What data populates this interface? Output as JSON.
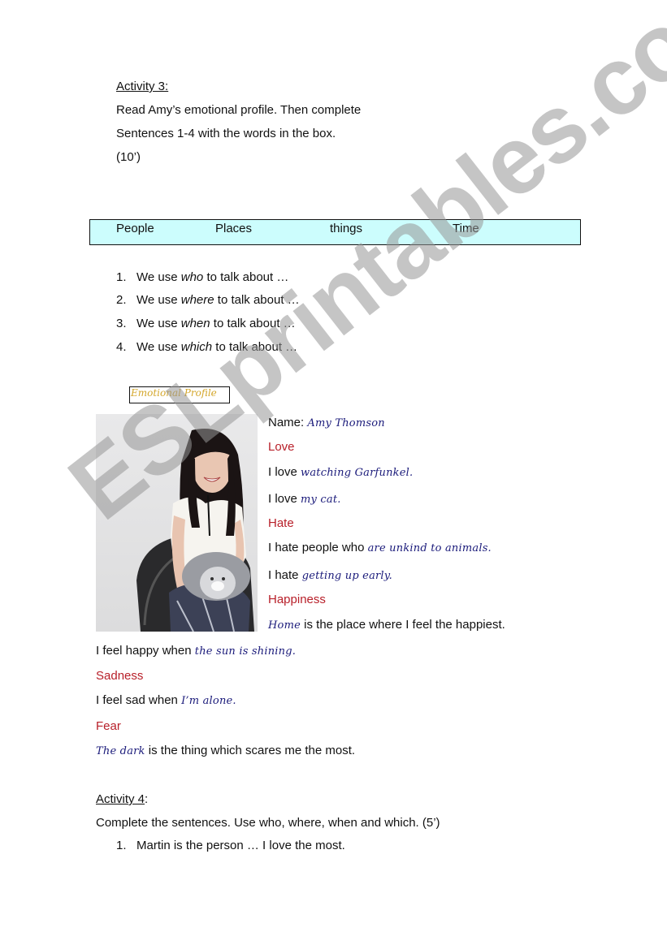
{
  "activity3": {
    "heading": "Activity 3:",
    "instruction_line1": "Read Amy’s emotional profile. Then complete",
    "instruction_line2": "Sentences 1-4 with the words in the box.",
    "time": "(10’)"
  },
  "word_box": {
    "words": [
      "People",
      "Places",
      "things",
      "Time"
    ],
    "background_color": "#ccfdfd"
  },
  "sentences": [
    {
      "num": "1.",
      "pre": "We use ",
      "word": "who",
      "post": " to talk about …"
    },
    {
      "num": "2.",
      "pre": "We use ",
      "word": "where",
      "post": " to talk about …"
    },
    {
      "num": "3.",
      "pre": "We use ",
      "word": "when",
      "post": " to talk about …"
    },
    {
      "num": "4.",
      "pre": "We use ",
      "word": "which",
      "post": " to talk about …"
    }
  ],
  "profile": {
    "title": "Emotional Profile",
    "photo_alt": "Smiling woman with long dark hair holding a grey fluffy cat, seated in a black chair",
    "name_label": "Name: ",
    "name_value": "Amy Thomson",
    "love_heading": "Love",
    "love1_pre": "I love ",
    "love1_value": "watching Garfunkel.",
    "love2_pre": "I love ",
    "love2_value": "my cat.",
    "hate_heading": "Hate",
    "hate1_pre": "I hate people who ",
    "hate1_value": "are unkind to animals.",
    "hate2_pre": "I hate ",
    "hate2_value": "getting up early.",
    "happiness_heading": "Happiness",
    "happy1_value": "Home",
    "happy1_post": " is the place where I feel the happiest.",
    "happy2_pre": "I feel happy when ",
    "happy2_value": "the sun is shining.",
    "sadness_heading": "Sadness",
    "sad_pre": "I feel sad when ",
    "sad_value": "I’m alone.",
    "fear_heading": "Fear",
    "fear_value": "The dark",
    "fear_post": " is the thing which scares me the most."
  },
  "activity4": {
    "heading": "Activity 4",
    "heading_colon": ":",
    "instruction": "Complete the sentences. Use who, where, when and which. (5’)",
    "items": [
      {
        "num": "1.",
        "text": "Martin is the person … I love the most."
      }
    ]
  },
  "colors": {
    "heading_red": "#b8202a",
    "handwriting_blue": "#1a1a7a",
    "profile_title_gold": "#d4a72c"
  },
  "watermark": "ESLprintables.com"
}
